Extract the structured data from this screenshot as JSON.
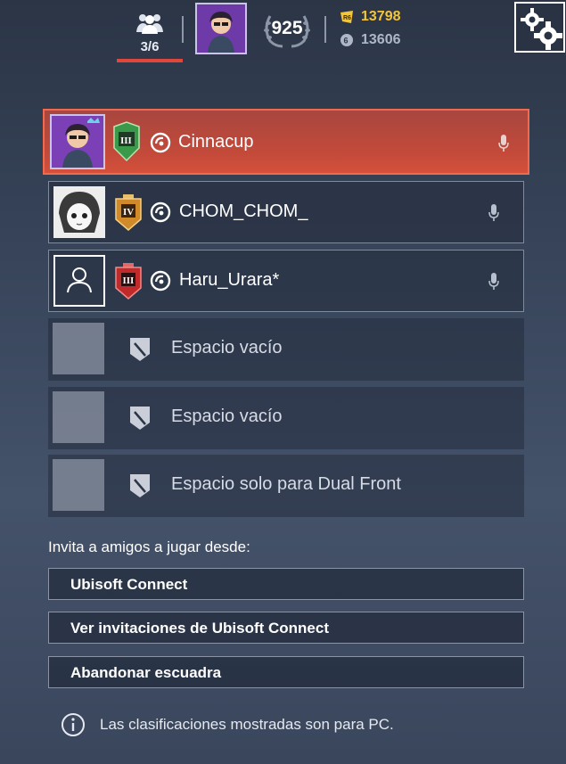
{
  "topbar": {
    "squad_count": "3/6",
    "level": "925",
    "r6_credits": "13798",
    "renown": "13606",
    "icons": {
      "squad": "people-icon",
      "level": "laurel-badge-icon",
      "r6_credits": "r6-credits-icon",
      "renown": "renown-icon",
      "settings": "gears-icon"
    }
  },
  "squad": {
    "players": [
      {
        "name": "Cinnacup",
        "leader": true,
        "rank_color": "#3a9a4a",
        "rank_numeral": "III"
      },
      {
        "name": "CHOM_CHOM_",
        "leader": false,
        "rank_color": "#d08a2a",
        "rank_numeral": "IV"
      },
      {
        "name": "Haru_Urara*",
        "leader": false,
        "rank_color": "#c12a2a",
        "rank_numeral": "III"
      }
    ],
    "empty_slots": [
      {
        "label": "Espacio vacío"
      },
      {
        "label": "Espacio vacío"
      },
      {
        "label": "Espacio solo para Dual Front"
      }
    ]
  },
  "invite": {
    "title": "Invita a amigos a jugar desde:",
    "buttons": [
      {
        "label": "Ubisoft Connect"
      },
      {
        "label": "Ver invitaciones de Ubisoft Connect"
      },
      {
        "label": "Abandonar escuadra"
      }
    ]
  },
  "footer": {
    "note": "Las clasificaciones mostradas son para PC."
  },
  "colors": {
    "accent_red": "#e0463a",
    "leader_bg": "#c44a3a",
    "currency_gold": "#f2c53a"
  }
}
